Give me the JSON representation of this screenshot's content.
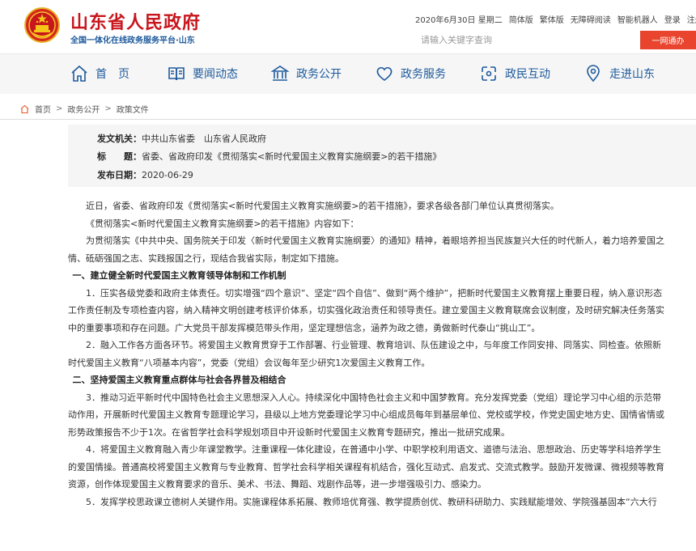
{
  "header": {
    "title": "山东省人民政府",
    "subtitle": "全国一体化在线政务服务平台·山东"
  },
  "topbar": {
    "date": "2020年6月30日 星期二",
    "simplified": "简体版",
    "traditional": "繁体版",
    "accessible": "无障碍阅读",
    "robot": "智能机器人",
    "login": "登录",
    "register": "注册"
  },
  "search": {
    "placeholder": "请输入关键字查询",
    "button": "一网通办"
  },
  "nav": {
    "items": [
      {
        "label": "首　页",
        "icon": "home-icon"
      },
      {
        "label": "要闻动态",
        "icon": "news-icon"
      },
      {
        "label": "政务公开",
        "icon": "government-icon"
      },
      {
        "label": "政务服务",
        "icon": "heart-service-icon"
      },
      {
        "label": "政民互动",
        "icon": "interaction-icon"
      },
      {
        "label": "走进山东",
        "icon": "location-icon"
      }
    ]
  },
  "breadcrumb": {
    "home": "首页",
    "level1": "政务公开",
    "level2": "政策文件",
    "sep": ">"
  },
  "meta": {
    "issuer_label": "发文机关：",
    "issuer": "中共山东省委　山东省人民政府",
    "title_label": "标　　题：",
    "title": "省委、省政府印发《贯彻落实<新时代爱国主义教育实施纲要>的若干措施》",
    "date_label": "发布日期：",
    "date": "2020-06-29"
  },
  "article": {
    "p1": "近日，省委、省政府印发《贯彻落实<新时代爱国主义教育实施纲要>的若干措施》，要求各级各部门单位认真贯彻落实。",
    "p2": "《贯彻落实<新时代爱国主义教育实施纲要>的若干措施》内容如下：",
    "p3": "为贯彻落实《中共中央、国务院关于印发〈新时代爱国主义教育实施纲要〉的通知》精神，着眼培养担当民族复兴大任的时代新人，着力培养爱国之情、砥砺强国之志、实践报国之行，现结合我省实际，制定如下措施。",
    "h1": "一、建立健全新时代爱国主义教育领导体制和工作机制",
    "p4": "1．压实各级党委和政府主体责任。切实增强“四个意识”、坚定“四个自信”、做到“两个维护”，把新时代爱国主义教育摆上重要日程，纳入意识形态工作责任制及专项检查内容，纳入精神文明创建考核评价体系，切实强化政治责任和领导责任。建立爱国主义教育联席会议制度，及时研究解决任务落实中的重要事项和存在问题。广大党员干部发挥模范带头作用，坚定理想信念，涵养为政之德，勇做新时代泰山“挑山工”。",
    "p5": "2．融入工作各方面各环节。将爱国主义教育贯穿于工作部署、行业管理、教育培训、队伍建设之中，与年度工作同安排、同落实、同检查。依照新时代爱国主义教育“八项基本内容”，党委（党组）会议每年至少研究1次爱国主义教育工作。",
    "h2": "二、坚持爱国主义教育重点群体与社会各界普及相结合",
    "p6": "3．推动习近平新时代中国特色社会主义思想深入人心。持续深化中国特色社会主义和中国梦教育。充分发挥党委（党组）理论学习中心组的示范带动作用，开展新时代爱国主义教育专题理论学习，县级以上地方党委理论学习中心组成员每年到基层单位、党校或学校，作党史国史地方史、国情省情或形势政策报告不少于1次。在省哲学社会科学规划项目中开设新时代爱国主义教育专题研究，推出一批研究成果。",
    "p7": "4．将爱国主义教育融入青少年课堂教学。注重课程一体化建设，在普通中小学、中职学校利用语文、道德与法治、思想政治、历史等学科培养学生的爱国情操。普通高校将爱国主义教育与专业教育、哲学社会科学相关课程有机结合，强化互动式、启发式、交流式教学。鼓励开发微课、微视频等教育资源，创作体现爱国主义教育要求的音乐、美术、书法、舞蹈、戏剧作品等，进一步增强吸引力、感染力。",
    "p8": "5．发挥学校思政课立德树人关键作用。实施课程体系拓展、教师培优育强、教学提质创优、教研科研助力、实践赋能增效、学院强基固本“六大行"
  }
}
